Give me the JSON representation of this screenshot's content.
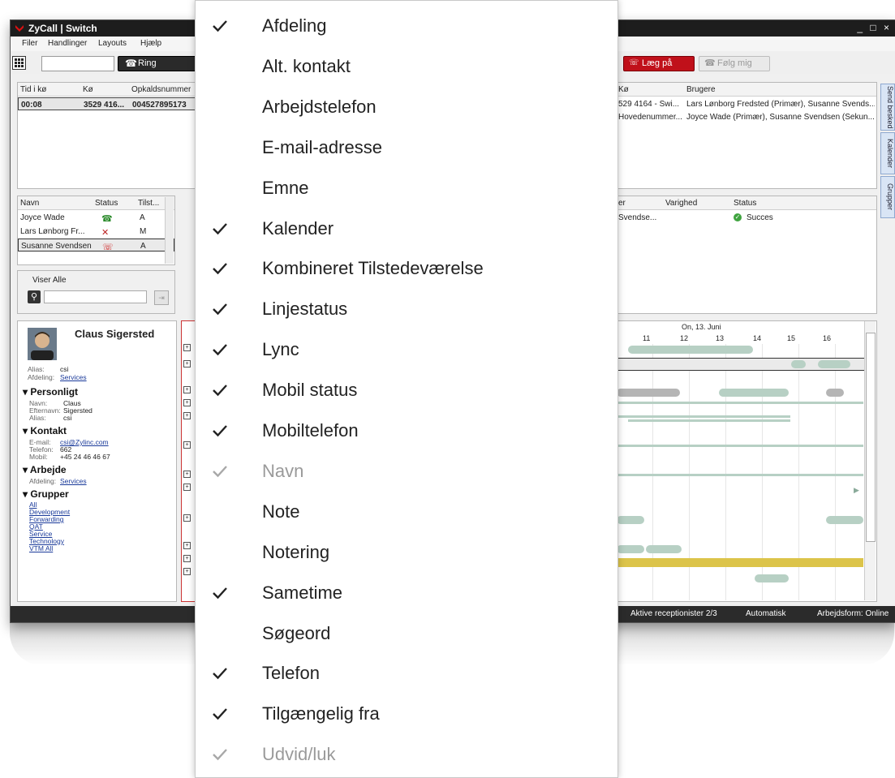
{
  "window": {
    "title": "ZyCall | Switch",
    "menu": [
      "Filer",
      "Handlinger",
      "Layouts",
      "Hjælp"
    ],
    "ring_label": "Ring",
    "hangup_label": "Læg på",
    "follow_label": "Følg mig"
  },
  "queue_table": {
    "headers": [
      "Tid i kø",
      "Kø",
      "Opkaldsnummer"
    ],
    "row": [
      "00:08",
      "3529 416...",
      "004527895173"
    ]
  },
  "queues_right": {
    "headers": [
      "Kø",
      "Brugere"
    ],
    "rows": [
      [
        "529 4164 - Swi...",
        "Lars Lønborg Fredsted (Primær), Susanne Svends..."
      ],
      [
        "Hovedenummer...",
        "Joyce Wade (Primær), Susanne Svendsen (Sekun..."
      ]
    ]
  },
  "users_table": {
    "headers": [
      "Navn",
      "Status",
      "Tilst..."
    ],
    "rows": [
      {
        "name": "Joyce Wade",
        "state": "A"
      },
      {
        "name": "Lars Lønborg Fr...",
        "state": "M"
      },
      {
        "name": "Susanne Svendsen",
        "state": "A"
      }
    ]
  },
  "filter": {
    "label": "Viser Alle"
  },
  "calls_right": {
    "headers": [
      "er",
      "Varighed",
      "Status"
    ],
    "row": [
      "Svendse...",
      "",
      "Succes"
    ]
  },
  "contact": {
    "name": "Claus Sigersted",
    "alias_label": "Alias:",
    "alias": "csi",
    "dept_label": "Afdeling:",
    "dept": "Services",
    "personal_title": "Personligt",
    "first_label": "Navn:",
    "first": "Claus",
    "last_label": "Efternavn:",
    "last": "Sigersted",
    "alias2_label": "Alias:",
    "alias2": "csi",
    "contact_title": "Kontakt",
    "email_label": "E-mail:",
    "email": "csi@Zylinc.com",
    "phone_label": "Telefon:",
    "phone": "662",
    "mobile_label": "Mobil:",
    "mobile": "+45 24 46 46 67",
    "work_title": "Arbejde",
    "dept2_label": "Afdeling:",
    "dept2": "Services",
    "groups_title": "Grupper",
    "groups": [
      "All",
      "Development",
      "Forwarding",
      "QAT",
      "Service",
      "Technology",
      "VTM All"
    ]
  },
  "calendar": {
    "date": "On, 13. Juni",
    "hours": [
      "11",
      "12",
      "13",
      "14",
      "15",
      "16"
    ]
  },
  "side_tabs": [
    "Send besked",
    "Kalender",
    "Grupper"
  ],
  "status_bar": {
    "receptionists": "Aktive receptionister 2/3",
    "mode": "Automatisk",
    "workform": "Arbejdsform: Online"
  },
  "dropdown": {
    "items": [
      {
        "label": "Afdeling",
        "checked": true,
        "disabled": false
      },
      {
        "label": "Alt. kontakt",
        "checked": false,
        "disabled": false
      },
      {
        "label": "Arbejdstelefon",
        "checked": false,
        "disabled": false
      },
      {
        "label": "E-mail-adresse",
        "checked": false,
        "disabled": false
      },
      {
        "label": "Emne",
        "checked": false,
        "disabled": false
      },
      {
        "label": "Kalender",
        "checked": true,
        "disabled": false
      },
      {
        "label": "Kombineret Tilstedeværelse",
        "checked": true,
        "disabled": false
      },
      {
        "label": "Linjestatus",
        "checked": true,
        "disabled": false
      },
      {
        "label": "Lync",
        "checked": true,
        "disabled": false
      },
      {
        "label": "Mobil status",
        "checked": true,
        "disabled": false
      },
      {
        "label": "Mobiltelefon",
        "checked": true,
        "disabled": false
      },
      {
        "label": "Navn",
        "checked": true,
        "disabled": true
      },
      {
        "label": "Note",
        "checked": false,
        "disabled": false
      },
      {
        "label": "Notering",
        "checked": false,
        "disabled": false
      },
      {
        "label": "Sametime",
        "checked": true,
        "disabled": false
      },
      {
        "label": "Søgeord",
        "checked": false,
        "disabled": false
      },
      {
        "label": "Telefon",
        "checked": true,
        "disabled": false
      },
      {
        "label": "Tilgængelig fra",
        "checked": true,
        "disabled": false
      },
      {
        "label": "Udvid/luk",
        "checked": true,
        "disabled": true
      }
    ]
  }
}
